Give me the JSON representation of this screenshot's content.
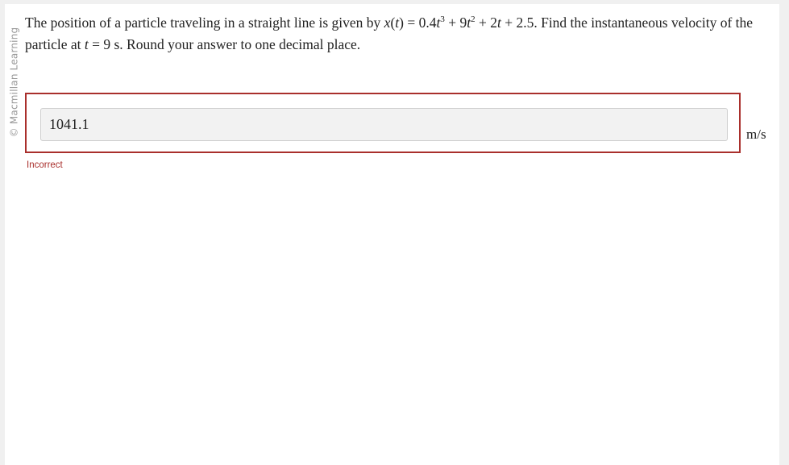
{
  "side_credit": "© Macmillan Learning",
  "question": {
    "p1": "The position of a particle traveling in a straight line is given by ",
    "x": "x",
    "paren_open": "(",
    "t1": "t",
    "eq_rhs_a": ") = 0.4",
    "t2": "t",
    "exp3": "3",
    "plus_9": " + 9",
    "t3": "t",
    "exp2": "2",
    "plus_2": " + 2",
    "t4": "t",
    "tail": " + 2.5. Find the instantaneous velocity of the particle at ",
    "t5": "t",
    "t_value": " = 9 s. Round your answer to one decimal place."
  },
  "answer": {
    "value": "1041.1",
    "unit": "m/s",
    "status": "Incorrect",
    "border_color": "#a92f2c"
  }
}
